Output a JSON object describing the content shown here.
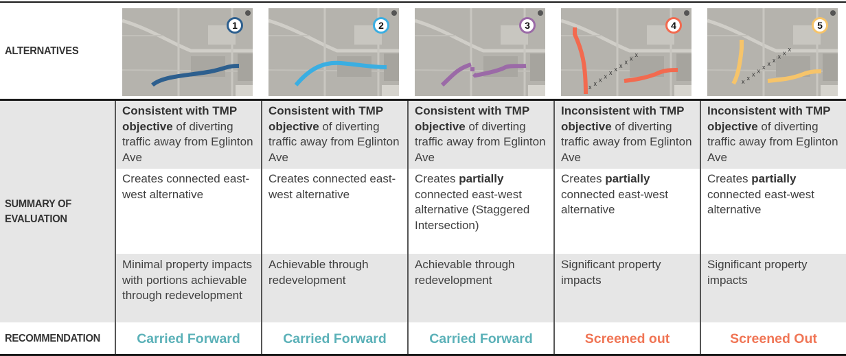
{
  "row_labels": {
    "alternatives": "ALTERNATIVES",
    "summary": "SUMMARY OF EVALUATION",
    "recommendation": "RECOMMENDATION"
  },
  "colors": {
    "carried_forward": "#5bb1b8",
    "screened_out": "#f07555",
    "alt1": "#2d5f8e",
    "alt2": "#3aaee2",
    "alt3": "#9b6aa7",
    "alt4": "#f26a4f",
    "alt5": "#f6c46a"
  },
  "alternatives": [
    {
      "number": "1",
      "map_icon": "aerial-map-route-1",
      "tmp": {
        "bold": "Consistent with TMP objective",
        "rest": " of diverting traffic away from Eglinton Ave"
      },
      "connectivity": {
        "pre": "Creates connected east-west alternative",
        "bold": "",
        "post": ""
      },
      "property": "Minimal property impacts with portions achievable through redevelopment",
      "recommendation": "Carried Forward",
      "status": "carried"
    },
    {
      "number": "2",
      "map_icon": "aerial-map-route-2",
      "tmp": {
        "bold": "Consistent with TMP objective",
        "rest": " of diverting traffic away from Eglinton Ave"
      },
      "connectivity": {
        "pre": "Creates connected east-west alternative",
        "bold": "",
        "post": ""
      },
      "property": "Achievable through redevelopment",
      "recommendation": "Carried Forward",
      "status": "carried"
    },
    {
      "number": "3",
      "map_icon": "aerial-map-route-3",
      "tmp": {
        "bold": "Consistent with TMP objective",
        "rest": " of diverting traffic away from Eglinton Ave"
      },
      "connectivity": {
        "pre": "Creates ",
        "bold": "partially",
        "post": " connected east-west alternative (Staggered Intersection)"
      },
      "property": "Achievable through redevelopment",
      "recommendation": "Carried Forward",
      "status": "carried"
    },
    {
      "number": "4",
      "map_icon": "aerial-map-route-4",
      "tmp": {
        "bold": "Inconsistent with TMP objective",
        "rest": " of diverting traffic away from Eglinton Ave"
      },
      "connectivity": {
        "pre": "Creates ",
        "bold": "partially",
        "post": " connected east-west alternative"
      },
      "property": "Significant property impacts",
      "recommendation": "Screened out",
      "status": "screened"
    },
    {
      "number": "5",
      "map_icon": "aerial-map-route-5",
      "tmp": {
        "bold": "Inconsistent with TMP objective",
        "rest": " of diverting traffic away from Eglinton Ave"
      },
      "connectivity": {
        "pre": "Creates ",
        "bold": "partially",
        "post": " connected east-west alternative"
      },
      "property": "Significant property impacts",
      "recommendation": "Screened Out",
      "status": "screened"
    }
  ]
}
